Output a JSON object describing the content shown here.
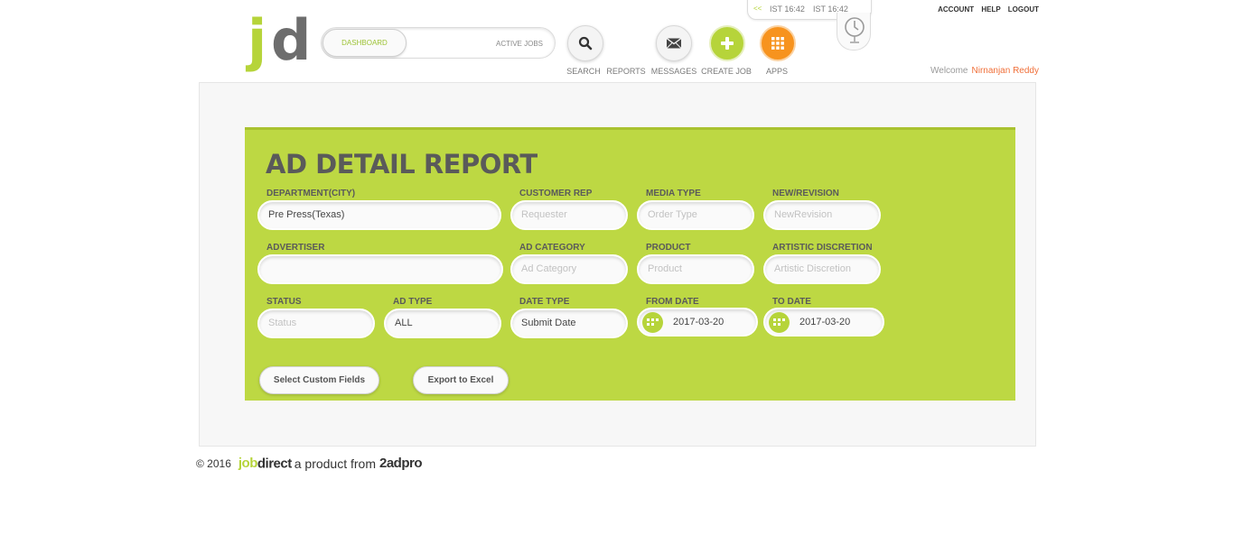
{
  "logo": {
    "j": "j",
    "d": "d"
  },
  "toggle": {
    "active": "DASHBOARD",
    "inactive": "ACTIVE JOBS"
  },
  "nav": {
    "search": "SEARCH",
    "reports": "REPORTS",
    "messages": "MESSAGES",
    "create_job": "CREATE JOB",
    "apps": "APPS"
  },
  "clock": {
    "arrow": "<<",
    "time1": "IST 16:42",
    "time2": "IST 16:42"
  },
  "toplinks": {
    "account": "ACCOUNT",
    "help": "HELP",
    "logout": "LOGOUT"
  },
  "welcome": {
    "label": "Welcome",
    "name": "Nirnanjan Reddy"
  },
  "report": {
    "title": "AD DETAIL REPORT",
    "fields": {
      "department": {
        "label": "DEPARTMENT(CITY)",
        "value": "Pre Press(Texas)"
      },
      "customer_rep": {
        "label": "CUSTOMER REP",
        "placeholder": "Requester"
      },
      "media_type": {
        "label": "MEDIA TYPE",
        "placeholder": "Order Type"
      },
      "new_revision": {
        "label": "NEW/REVISION",
        "placeholder": "NewRevision"
      },
      "advertiser": {
        "label": "ADVERTISER",
        "value": ""
      },
      "ad_category": {
        "label": "AD CATEGORY",
        "placeholder": "Ad Category"
      },
      "product": {
        "label": "PRODUCT",
        "placeholder": "Product"
      },
      "artistic": {
        "label": "ARTISTIC DISCRETION",
        "placeholder": "Artistic Discretion"
      },
      "status": {
        "label": "STATUS",
        "placeholder": "Status"
      },
      "ad_type": {
        "label": "AD TYPE",
        "value": "ALL"
      },
      "date_type": {
        "label": "DATE TYPE",
        "value": "Submit Date"
      },
      "from_date": {
        "label": "FROM DATE",
        "value": "2017-03-20"
      },
      "to_date": {
        "label": "TO DATE",
        "value": "2017-03-20"
      }
    },
    "buttons": {
      "custom_fields": "Select Custom Fields",
      "export": "Export to Excel"
    }
  },
  "footer": {
    "copyright": "© 2016",
    "brand_job": "job",
    "brand_direct": "direct",
    "tagline": "a product from",
    "brand_partner": "2adpro"
  },
  "colors": {
    "accent_green": "#bdd843",
    "accent_orange": "#f7931e",
    "welcome_name": "#f0703a"
  }
}
